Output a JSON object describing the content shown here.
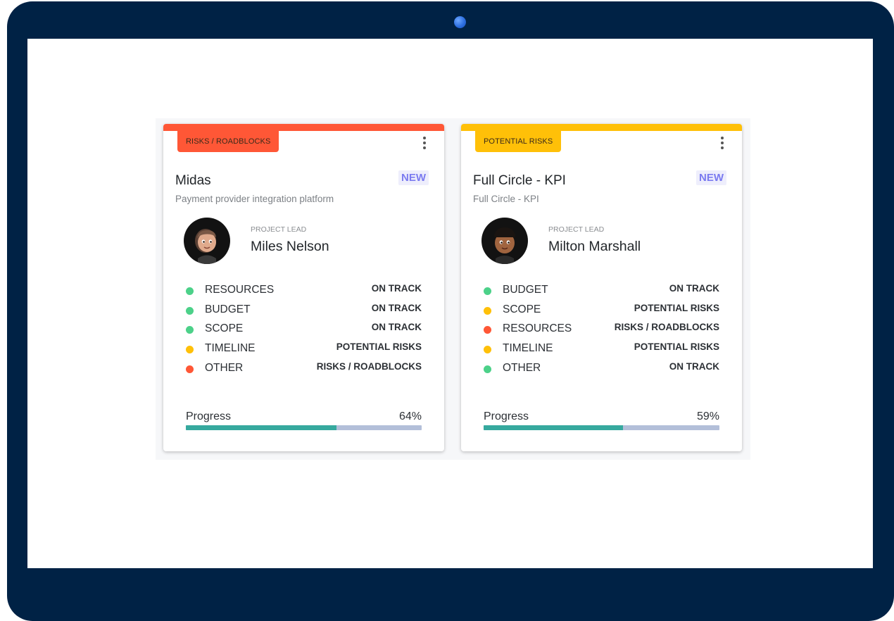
{
  "colors": {
    "on_track": "#4cd189",
    "potential_risks": "#ffc008",
    "risks_roadblocks": "#ff5736",
    "progress_fill": "#36a99e",
    "progress_track": "#b3bfd9",
    "device_frame": "#002245"
  },
  "icons": {
    "menu": "vertical-dots-icon",
    "camera": "camera-icon"
  },
  "cards": [
    {
      "tag": "RISKS / ROADBLOCKS",
      "tag_color": "#ff5736",
      "title": "Midas",
      "subtitle": "Payment provider integration platform",
      "badge": "NEW",
      "lead_label": "PROJECT LEAD",
      "lead_name": "Miles Nelson",
      "metrics": [
        {
          "label": "RESOURCES",
          "status": "ON TRACK",
          "color": "#4cd189"
        },
        {
          "label": "BUDGET",
          "status": "ON TRACK",
          "color": "#4cd189"
        },
        {
          "label": "SCOPE",
          "status": "ON TRACK",
          "color": "#4cd189"
        },
        {
          "label": "TIMELINE",
          "status": "POTENTIAL RISKS",
          "color": "#ffc008"
        },
        {
          "label": "OTHER",
          "status": "RISKS / ROADBLOCKS",
          "color": "#ff5736"
        }
      ],
      "progress_label": "Progress",
      "progress_value": "64%",
      "progress": 0.64
    },
    {
      "tag": "POTENTIAL RISKS",
      "tag_color": "#ffc008",
      "title": "Full Circle - KPI",
      "subtitle": "Full Circle - KPI",
      "badge": "NEW",
      "lead_label": "PROJECT LEAD",
      "lead_name": "Milton Marshall",
      "metrics": [
        {
          "label": "BUDGET",
          "status": "ON TRACK",
          "color": "#4cd189"
        },
        {
          "label": "SCOPE",
          "status": "POTENTIAL RISKS",
          "color": "#ffc008"
        },
        {
          "label": "RESOURCES",
          "status": "RISKS / ROADBLOCKS",
          "color": "#ff5736"
        },
        {
          "label": "TIMELINE",
          "status": "POTENTIAL RISKS",
          "color": "#ffc008"
        },
        {
          "label": "OTHER",
          "status": "ON TRACK",
          "color": "#4cd189"
        }
      ],
      "progress_label": "Progress",
      "progress_value": "59%",
      "progress": 0.59
    }
  ]
}
